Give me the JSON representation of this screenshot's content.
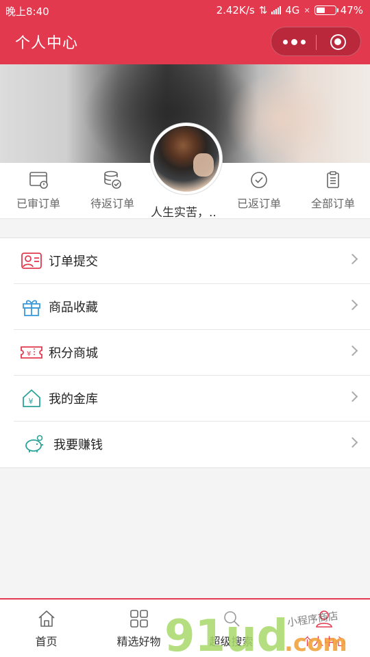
{
  "status": {
    "time": "晚上8:40",
    "speed": "2.42K/s",
    "network": "4G",
    "battery": "47%",
    "battery_level": 0.47
  },
  "header": {
    "title": "个人中心",
    "menu_icon": "more-dots-icon",
    "close_icon": "target-close-icon"
  },
  "profile": {
    "nickname": "人生实苦，..",
    "avatar_icon": "user-avatar"
  },
  "orders": [
    {
      "label": "已审订单",
      "icon": "reviewed-order-icon"
    },
    {
      "label": "待返订单",
      "icon": "pending-return-icon"
    },
    {
      "label": "已返订单",
      "icon": "returned-order-icon"
    },
    {
      "label": "全部订单",
      "icon": "clipboard-icon"
    }
  ],
  "menu": [
    {
      "label": "订单提交",
      "icon": "id-card-icon"
    },
    {
      "label": "商品收藏",
      "icon": "gift-icon"
    },
    {
      "label": "积分商城",
      "icon": "ticket-icon"
    },
    {
      "label": "我的金库",
      "icon": "house-yen-icon"
    },
    {
      "label": "我要赚钱",
      "icon": "piggy-bank-icon"
    }
  ],
  "tabs": [
    {
      "label": "首页",
      "icon": "home-icon"
    },
    {
      "label": "精选好物",
      "icon": "grid-icon"
    },
    {
      "label": "超级搜索",
      "icon": "search-icon"
    },
    {
      "label": "个人中心",
      "icon": "user-icon"
    }
  ],
  "colors": {
    "brand": "#e2394e",
    "icon_gray": "#666666",
    "icon_teal": "#2aa39a",
    "icon_blue": "#3a9ad9",
    "icon_red": "#e2394e"
  },
  "watermark": {
    "text": "91ud",
    "domain": ".com",
    "small": "小程序商店"
  }
}
